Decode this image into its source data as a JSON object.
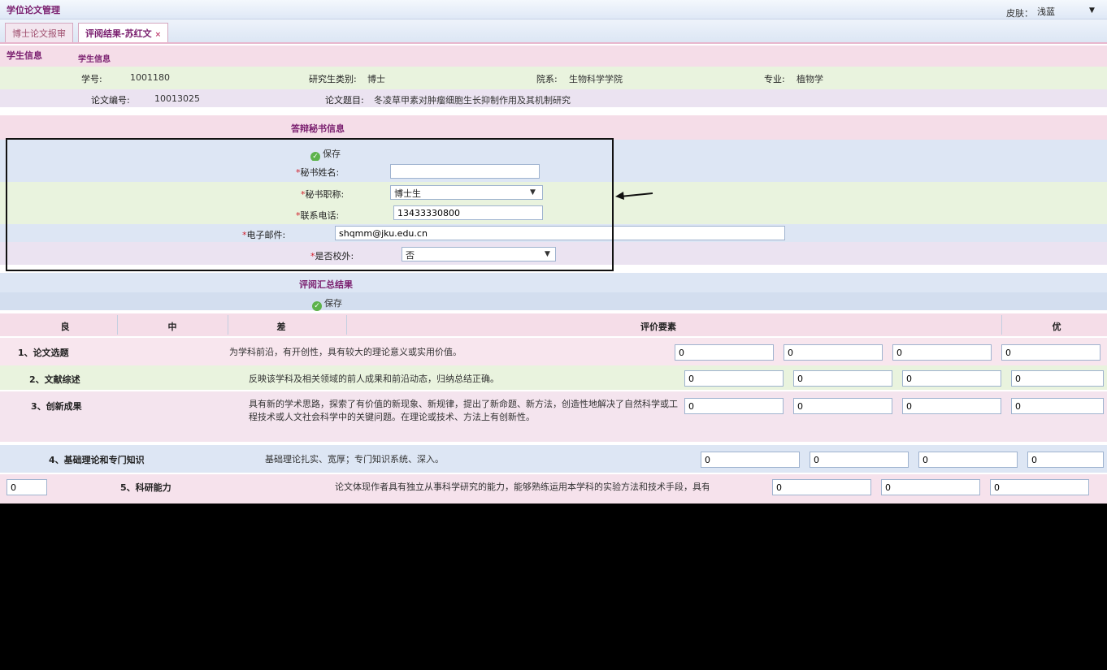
{
  "app": {
    "title": "学位论文管理"
  },
  "skin": {
    "label": "皮肤：",
    "value": "浅蓝"
  },
  "tabs": [
    {
      "label": "博士论文报审"
    },
    {
      "label": "评阅结果-苏红文",
      "close": "×"
    }
  ],
  "student": {
    "section_title": "学生信息",
    "sub_title": "学生信息",
    "student_id_label": "学号:",
    "student_id": "1001180",
    "degree_level_label": "研究生类别:",
    "degree_level": "博士",
    "department_label": "院系:",
    "department": "生物科学学院",
    "major_label": "专业:",
    "major": "植物学",
    "thesis_no_label": "论文编号:",
    "thesis_no": "10013025",
    "thesis_title_label": "论文题目:",
    "thesis_title": "冬凌草甲素对肿瘤细胞生长抑制作用及其机制研究"
  },
  "secretary": {
    "section_title": "答辩秘书信息",
    "save_label": "保存",
    "name_label": "秘书姓名:",
    "name_value": "",
    "title_label": "秘书职称:",
    "title_value": "博士生",
    "phone_label": "联系电话:",
    "phone_value": "13433330800",
    "email_label": "电子邮件:",
    "email_value": "shqmm@jku.edu.cn",
    "outside_label": "是否校外:",
    "outside_value": "否"
  },
  "summary": {
    "section_title": "评阅汇总结果",
    "save_label": "保存"
  },
  "table": {
    "headers": [
      "良",
      "中",
      "差",
      "评价要素",
      "优"
    ],
    "rows": [
      {
        "name": "1、论文选题",
        "desc": "为学科前沿，有开创性，具有较大的理论意义或实用价值。",
        "scores": [
          "0",
          "0",
          "0",
          "0"
        ]
      },
      {
        "name": "2、文献综述",
        "desc": "反映该学科及相关领域的前人成果和前沿动态，归纳总结正确。",
        "scores": [
          "0",
          "0",
          "0",
          "0"
        ]
      },
      {
        "name": "3、创新成果",
        "desc": "具有新的学术思路，探索了有价值的新现象、新规律，提出了新命题、新方法，创造性地解决了自然科学或工程技术或人文社会科学中的关键问题。在理论或技术、方法上有创新性。",
        "scores": [
          "0",
          "0",
          "0",
          "0"
        ]
      },
      {
        "name": "4、基础理论和专门知识",
        "desc": "基础理论扎实、宽厚；专门知识系统、深入。",
        "scores": [
          "0",
          "0",
          "0",
          "0"
        ]
      },
      {
        "name": "5、科研能力",
        "desc": "论文体现作者具有独立从事科学研究的能力，能够熟练运用本学科的实验方法和技术手段，具有解决实际问题的能力。",
        "scores": [
          "0",
          "0",
          "0",
          "0"
        ]
      }
    ]
  }
}
